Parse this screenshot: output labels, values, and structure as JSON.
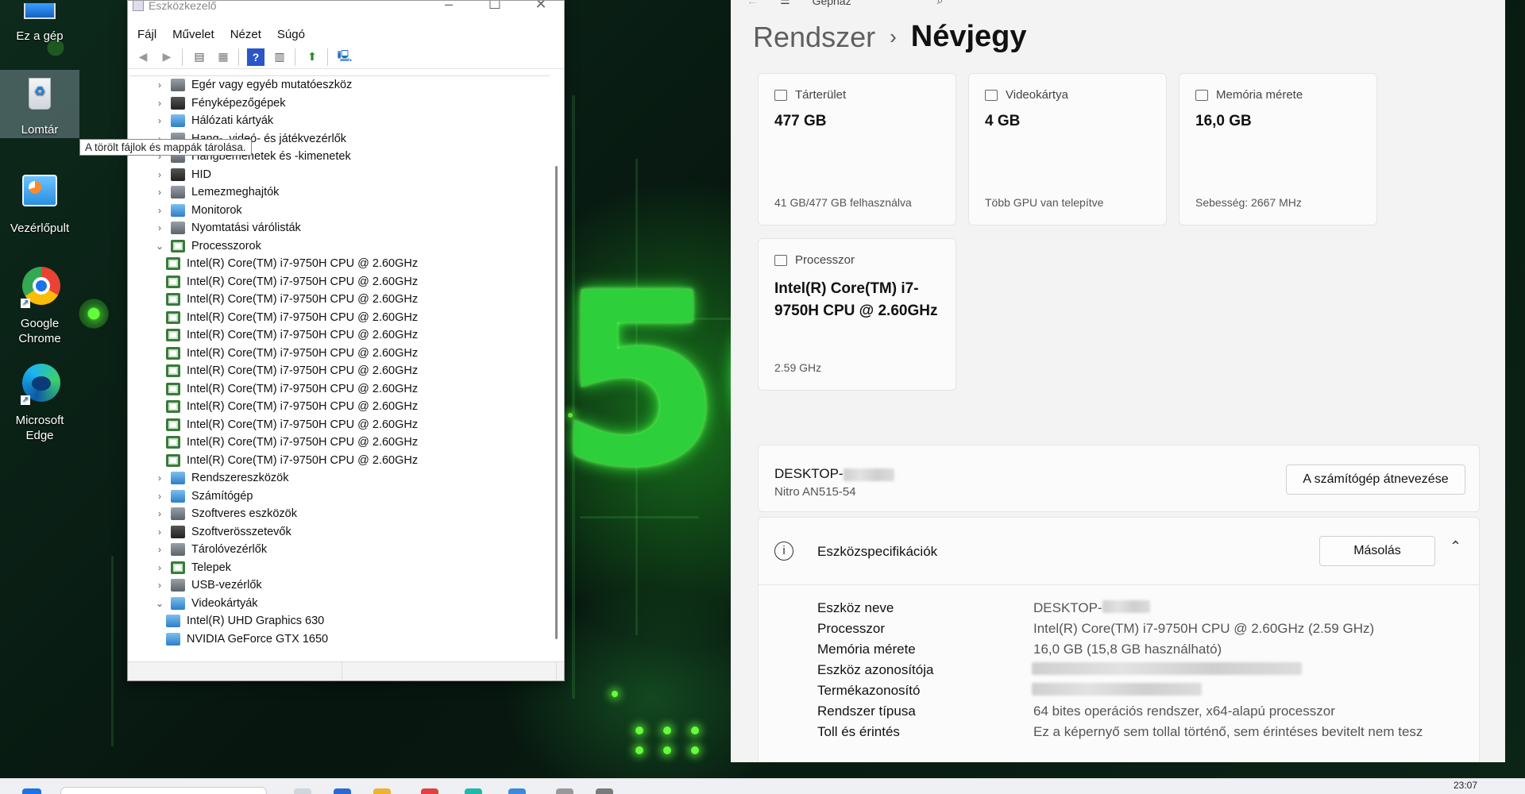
{
  "desktop": {
    "icons": [
      {
        "label": "Ez a gép"
      },
      {
        "label": "Lomtár"
      },
      {
        "label": "Vezérlőpult"
      },
      {
        "label": "Google Chrome"
      },
      {
        "label": "Microsoft Edge"
      }
    ],
    "tooltip": "A törölt fájlok és mappák tárolása."
  },
  "devmgr": {
    "title": "Eszközkezelő",
    "menu": [
      "Fájl",
      "Művelet",
      "Nézet",
      "Súgó"
    ],
    "tree": [
      {
        "label": "Egér vagy egyéb mutatóeszköz",
        "icon": "gray",
        "expanded": false
      },
      {
        "label": "Fényképezőgépek",
        "icon": "dark",
        "expanded": false
      },
      {
        "label": "Hálózati kártyák",
        "icon": "blue",
        "expanded": false
      },
      {
        "label": "Hang-, videó- és játékvezérlők",
        "icon": "gray",
        "expanded": false
      },
      {
        "label": "Hangbemenetek és -kimenetek",
        "icon": "gray",
        "expanded": false
      },
      {
        "label": "HID",
        "icon": "dark",
        "expanded": false
      },
      {
        "label": "Lemezmeghajtók",
        "icon": "gray",
        "expanded": false
      },
      {
        "label": "Monitorok",
        "icon": "blue",
        "expanded": false
      },
      {
        "label": "Nyomtatási várólisták",
        "icon": "gray",
        "expanded": false
      },
      {
        "label": "Processzorok",
        "icon": "green",
        "expanded": true
      },
      {
        "label": "Intel(R) Core(TM) i7-9750H CPU @ 2.60GHz",
        "icon": "green",
        "child": true
      },
      {
        "label": "Intel(R) Core(TM) i7-9750H CPU @ 2.60GHz",
        "icon": "green",
        "child": true
      },
      {
        "label": "Intel(R) Core(TM) i7-9750H CPU @ 2.60GHz",
        "icon": "green",
        "child": true
      },
      {
        "label": "Intel(R) Core(TM) i7-9750H CPU @ 2.60GHz",
        "icon": "green",
        "child": true
      },
      {
        "label": "Intel(R) Core(TM) i7-9750H CPU @ 2.60GHz",
        "icon": "green",
        "child": true
      },
      {
        "label": "Intel(R) Core(TM) i7-9750H CPU @ 2.60GHz",
        "icon": "green",
        "child": true
      },
      {
        "label": "Intel(R) Core(TM) i7-9750H CPU @ 2.60GHz",
        "icon": "green",
        "child": true
      },
      {
        "label": "Intel(R) Core(TM) i7-9750H CPU @ 2.60GHz",
        "icon": "green",
        "child": true
      },
      {
        "label": "Intel(R) Core(TM) i7-9750H CPU @ 2.60GHz",
        "icon": "green",
        "child": true
      },
      {
        "label": "Intel(R) Core(TM) i7-9750H CPU @ 2.60GHz",
        "icon": "green",
        "child": true
      },
      {
        "label": "Intel(R) Core(TM) i7-9750H CPU @ 2.60GHz",
        "icon": "green",
        "child": true
      },
      {
        "label": "Intel(R) Core(TM) i7-9750H CPU @ 2.60GHz",
        "icon": "green",
        "child": true
      },
      {
        "label": "Rendszereszközök",
        "icon": "blue",
        "expanded": false
      },
      {
        "label": "Számítógép",
        "icon": "blue",
        "expanded": false
      },
      {
        "label": "Szoftveres eszközök",
        "icon": "gray",
        "expanded": false
      },
      {
        "label": "Szoftverösszetevők",
        "icon": "dark",
        "expanded": false
      },
      {
        "label": "Tárolóvezérlők",
        "icon": "gray",
        "expanded": false
      },
      {
        "label": "Telepek",
        "icon": "green",
        "expanded": false
      },
      {
        "label": "USB-vezérlők",
        "icon": "gray",
        "expanded": false
      },
      {
        "label": "Videokártyák",
        "icon": "blue",
        "expanded": true
      },
      {
        "label": "Intel(R) UHD Graphics 630",
        "icon": "blue",
        "child": true
      },
      {
        "label": "NVIDIA GeForce GTX 1650",
        "icon": "blue",
        "child": true
      }
    ]
  },
  "settings": {
    "top_label": "Gépház",
    "breadcrumb": {
      "parent": "Rendszer",
      "current": "Névjegy"
    },
    "cards": {
      "storage": {
        "title": "Tárterület",
        "value": "477 GB",
        "sub": "41 GB/477 GB felhasználva"
      },
      "gpu": {
        "title": "Videokártya",
        "value": "4 GB",
        "sub": "Több GPU van telepítve"
      },
      "memory": {
        "title": "Memória mérete",
        "value": "16,0 GB",
        "sub": "Sebesség: 2667 MHz"
      },
      "cpu": {
        "title": "Processzor",
        "value": "Intel(R) Core(TM) i7-9750H CPU @ 2.60GHz",
        "sub": "2.59 GHz"
      }
    },
    "device": {
      "name_prefix": "DESKTOP-",
      "model": "Nitro AN515-54",
      "rename_button": "A számítógép átnevezése"
    },
    "specs": {
      "title": "Eszközspecifikációk",
      "copy_button": "Másolás",
      "rows": [
        {
          "key": "Eszköz neve",
          "value": "DESKTOP-"
        },
        {
          "key": "Processzor",
          "value": "Intel(R) Core(TM) i7-9750H CPU @ 2.60GHz (2.59 GHz)"
        },
        {
          "key": "Memória mérete",
          "value": "16,0 GB (15,8 GB használható)"
        },
        {
          "key": "Eszköz azonosítója",
          "value": ""
        },
        {
          "key": "Termékazonosító",
          "value": ""
        },
        {
          "key": "Rendszer típusa",
          "value": "64 bites operációs rendszer, x64-alapú processzor"
        },
        {
          "key": "Toll és érintés",
          "value": "Ez a képernyő sem tollal történő, sem érintéses bevitelt nem tesz"
        }
      ]
    }
  },
  "taskbar": {
    "time": "23:07"
  }
}
